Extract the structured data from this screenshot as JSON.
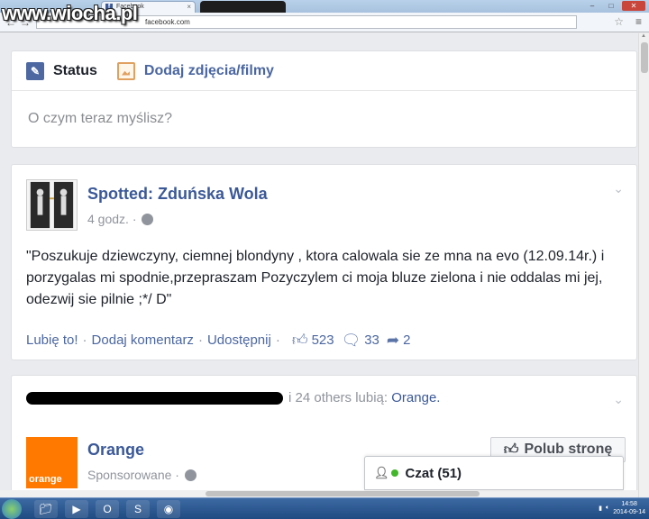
{
  "browser": {
    "tab_active_title": "Facebook",
    "url": "facebook.com",
    "watermark": "www.wiocha.pl"
  },
  "composer": {
    "status_label": "Status",
    "photo_label": "Dodaj zdjęcia/filmy",
    "placeholder": "O czym teraz myślisz?"
  },
  "post": {
    "page_name": "Spotted: Zduńska Wola",
    "time": "4 godz. ·",
    "text": "\"Poszukuje dziewczyny, ciemnej blondyny , ktora calowala sie ze mna na evo (12.09.14r.) i porzygalas mi spodnie,przepraszam Pozyczylem ci moja bluze zielona i nie oddalas mi jej, odezwij sie pilnie ;*/ D\"",
    "like_label": "Lubię to!",
    "comment_label": "Dodaj komentarz",
    "share_label": "Udostępnij",
    "likes": "523",
    "comments": "33",
    "shares": "2"
  },
  "ad": {
    "likers_suffix": "i 24 others lubią:",
    "likers_page": "Orange.",
    "name": "Orange",
    "logo_text": "orange",
    "sponsored": "Sponsorowane ·",
    "like_page_button": "Polub stronę"
  },
  "chat": {
    "label": "Czat (51)"
  },
  "taskbar": {
    "time": "14:58",
    "date": "2014-09-14"
  },
  "icons": [
    "pencil-icon",
    "photo-icon",
    "globe-icon",
    "chevron-down-icon",
    "thumbs-up-icon",
    "comment-icon",
    "share-icon",
    "people-icon",
    "star-icon",
    "menu-icon"
  ]
}
